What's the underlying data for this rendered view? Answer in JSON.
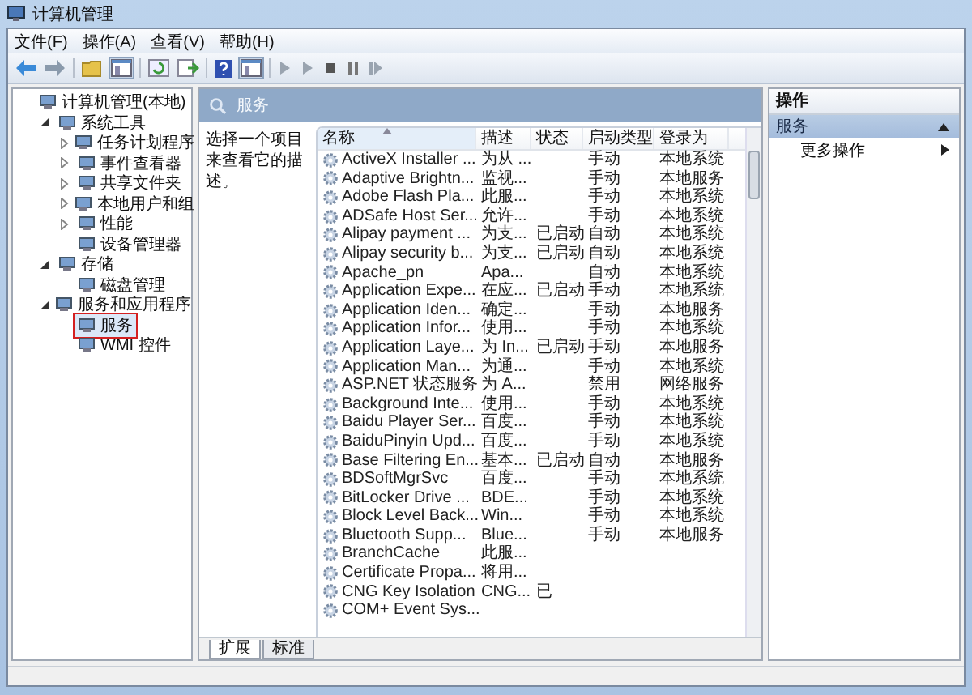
{
  "window": {
    "title": "计算机管理"
  },
  "menu": [
    "文件(F)",
    "操作(A)",
    "查看(V)",
    "帮助(H)"
  ],
  "tree": [
    {
      "label": "计算机管理(本地)",
      "selected": false,
      "children": [
        {
          "label": "系统工具",
          "selected": false,
          "expanded": true,
          "children": [
            {
              "label": "任务计划程序",
              "selected": false,
              "expanded": false
            },
            {
              "label": "事件查看器",
              "selected": false,
              "expanded": false
            },
            {
              "label": "共享文件夹",
              "selected": false,
              "expanded": false
            },
            {
              "label": "本地用户和组",
              "selected": false,
              "expanded": false
            },
            {
              "label": "性能",
              "selected": false,
              "expanded": false
            },
            {
              "label": "设备管理器",
              "selected": false
            }
          ]
        },
        {
          "label": "存储",
          "selected": false,
          "expanded": true,
          "children": [
            {
              "label": "磁盘管理",
              "selected": false
            }
          ]
        },
        {
          "label": "服务和应用程序",
          "selected": false,
          "expanded": true,
          "children": [
            {
              "label": "服务",
              "selected": true
            },
            {
              "label": "WMI 控件",
              "selected": false
            }
          ]
        }
      ]
    }
  ],
  "content": {
    "title": "服务",
    "description": "选择一个项目来查看它的描述。"
  },
  "table": {
    "columns": [
      "名称",
      "描述",
      "状态",
      "启动类型",
      "登录为"
    ],
    "rows": [
      {
        "name": "ActiveX Installer ...",
        "description": "为从 ...",
        "startup": "手动",
        "logon": "本地系统"
      },
      {
        "name": "Adaptive Brightn...",
        "description": "监视...",
        "startup": "手动",
        "logon": "本地服务"
      },
      {
        "name": "Adobe Flash Pla...",
        "description": "此服...",
        "startup": "手动",
        "logon": "本地系统"
      },
      {
        "name": "ADSafe Host Ser...",
        "description": "允许...",
        "startup": "手动",
        "logon": "本地系统"
      },
      {
        "name": "Alipay payment ...",
        "description": "为支...",
        "status": "已启动",
        "startup": "自动",
        "logon": "本地系统"
      },
      {
        "name": "Alipay security b...",
        "description": "为支...",
        "status": "已启动",
        "startup": "自动",
        "logon": "本地系统"
      },
      {
        "name": "Apache_pn",
        "description": "Apa...",
        "startup": "自动",
        "logon": "本地系统"
      },
      {
        "name": "Application Expe...",
        "description": "在应...",
        "status": "已启动",
        "startup": "手动",
        "logon": "本地系统"
      },
      {
        "name": "Application Iden...",
        "description": "确定...",
        "startup": "手动",
        "logon": "本地服务"
      },
      {
        "name": "Application Infor...",
        "description": "使用...",
        "startup": "手动",
        "logon": "本地系统"
      },
      {
        "name": "Application Laye...",
        "description": "为 In...",
        "status": "已启动",
        "startup": "手动",
        "logon": "本地服务"
      },
      {
        "name": "Application Man...",
        "description": "为通...",
        "startup": "手动",
        "logon": "本地系统"
      },
      {
        "name": "ASP.NET 状态服务",
        "description": "为 A...",
        "startup": "禁用",
        "logon": "网络服务"
      },
      {
        "name": "Background Inte...",
        "description": "使用...",
        "startup": "手动",
        "logon": "本地系统"
      },
      {
        "name": "Baidu Player Ser...",
        "description": "百度...",
        "startup": "手动",
        "logon": "本地系统"
      },
      {
        "name": "BaiduPinyin Upd...",
        "description": "百度...",
        "startup": "手动",
        "logon": "本地系统"
      },
      {
        "name": "Base Filtering En...",
        "description": "基本...",
        "status": "已启动",
        "startup": "自动",
        "logon": "本地服务"
      },
      {
        "name": "BDSoftMgrSvc",
        "description": "百度...",
        "startup": "手动",
        "logon": "本地系统"
      },
      {
        "name": "BitLocker Drive ...",
        "description": "BDE...",
        "startup": "手动",
        "logon": "本地系统"
      },
      {
        "name": "Block Level Back...",
        "description": "Win...",
        "startup": "手动",
        "logon": "本地系统"
      },
      {
        "name": "Bluetooth Supp...",
        "description": "Blue...",
        "startup": "手动",
        "logon": "本地服务"
      },
      {
        "name": "BranchCache",
        "description": "此服..."
      },
      {
        "name": "Certificate Propa...",
        "description": "将用..."
      },
      {
        "name": "CNG Key Isolation",
        "description": "CNG...",
        "status": "已"
      },
      {
        "name": "COM+ Event Sys..."
      }
    ]
  },
  "bottom_tabs": [
    {
      "label": "扩展",
      "selected": true
    },
    {
      "label": "标准",
      "selected": false
    }
  ],
  "actions": {
    "title": "操作",
    "section": "服务",
    "expanded": true,
    "items": [
      "更多操作"
    ]
  }
}
